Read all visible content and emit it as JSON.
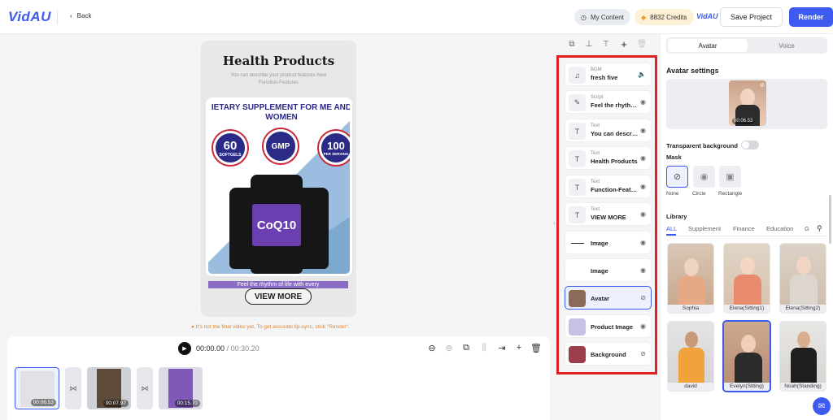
{
  "header": {
    "logo": "VidAU",
    "back": "Back",
    "my_content": "My Content",
    "credits": "8832 Credits",
    "small_logo": "VidAU",
    "save_project": "Save Project",
    "render": "Render"
  },
  "canvas": {
    "title": "Health Products",
    "subtitle": "You can describe your product features here",
    "subtitle2": "Function-Features",
    "product_headline": "IETARY SUPPLEMENT FOR ME AND WOMEN",
    "badge_1_num": "60",
    "badge_1_text": "SOFTGELS",
    "badge_2_text": "GMP",
    "badge_3_num": "100",
    "badge_3_text": "PER SERVING",
    "bottle_label": "CoQ10",
    "tagline": "Feel the rhythm of life with every",
    "cta": "VIEW MORE",
    "warning": "It's not the final video yet, To get accurate lip-sync, click \"Render\"."
  },
  "timeline": {
    "current": "00:00.00",
    "total": "/ 00:30.20",
    "clips": [
      {
        "duration": "00:06.53"
      },
      {
        "duration": "00:07.97"
      },
      {
        "duration": "00:15.70"
      }
    ]
  },
  "layers": [
    {
      "caption": "BGM",
      "name": "fresh five",
      "icon": "music-note-icon"
    },
    {
      "caption": "Script",
      "name": "Feel the rhythm of life",
      "icon": "script-icon"
    },
    {
      "caption": "Text",
      "name": "You can describe",
      "icon": "text-icon"
    },
    {
      "caption": "Text",
      "name": "Health Products",
      "icon": "text-icon"
    },
    {
      "caption": "Text",
      "name": "Function-Features",
      "icon": "text-icon"
    },
    {
      "caption": "Text",
      "name": "VIEW MORE",
      "icon": "text-icon"
    },
    {
      "caption": "",
      "name": "Image",
      "icon": "image-icon"
    },
    {
      "caption": "",
      "name": "Image",
      "icon": "image-icon"
    },
    {
      "caption": "",
      "name": "Avatar",
      "icon": "avatar-icon"
    },
    {
      "caption": "",
      "name": "Product Image",
      "icon": "product-icon"
    },
    {
      "caption": "",
      "name": "Background",
      "icon": "background-icon"
    }
  ],
  "right_panel": {
    "tab_avatar": "Avatar",
    "tab_voice": "Voice",
    "avatar_settings": "Avatar settings",
    "preview_duration": "00:06.53",
    "transparent_bg": "Transparent background",
    "mask": "Mask",
    "mask_options": [
      "None",
      "Circle",
      "Rectangle"
    ],
    "library": "Library",
    "library_tabs": [
      "ALL",
      "Supplement",
      "Finance",
      "Education",
      "G"
    ],
    "avatars": [
      "Sophia",
      "Elena(Sitting1)",
      "Elena(Sitting2)",
      "david",
      "Evelyn(Sitting)",
      "Noah(Standing)"
    ]
  },
  "colors": {
    "accent": "#3d5af1",
    "highlight_border": "#e22222",
    "warning": "#e3862b"
  }
}
